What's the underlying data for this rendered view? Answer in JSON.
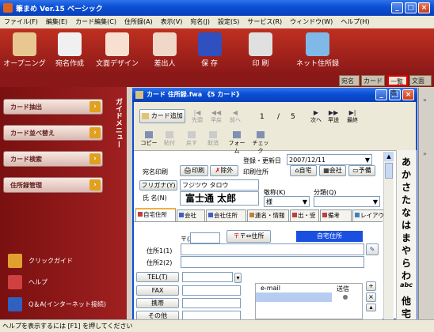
{
  "app": {
    "title": "筆まめ Ver.15 ベーシック"
  },
  "menu": [
    "ファイル(F)",
    "編集(E)",
    "カード編集(C)",
    "住所録(A)",
    "表示(V)",
    "宛名(J)",
    "設定(S)",
    "サービス(R)",
    "ウィンドウ(W)",
    "ヘルプ(H)"
  ],
  "toolbar": [
    "オープニング",
    "宛名作成",
    "文面デザイン",
    "差出人",
    "保 存",
    "印 刷",
    "ネット住所録"
  ],
  "right_tabs": [
    "宛名",
    "カード",
    "一覧表",
    "文面"
  ],
  "guide": {
    "title": "ガイドメニュー",
    "buttons": [
      "カード抽出",
      "カード並べ替え",
      "カード検索",
      "住所録管理"
    ],
    "links": [
      "クリックガイド",
      "ヘルプ",
      "Q＆A(インターネット接続)"
    ]
  },
  "card": {
    "title": "カード 住所録.fwa 《5 カード》",
    "add_btn": "カード追加",
    "nav": [
      "先頭",
      "早戻",
      "前へ"
    ],
    "page_current": "1",
    "page_sep": "/",
    "page_total": "5",
    "nav2": [
      "次へ",
      "早送",
      "最終"
    ],
    "edit": [
      "コピー",
      "貼付",
      "戻す",
      "取消",
      "フォーム",
      "チェック"
    ],
    "reg_label": "登録・更新日",
    "reg_date": "2007/12/11",
    "atena_label": "宛名印刷",
    "print_btn": "印刷",
    "exclude_btn": "除外",
    "addr_label": "印刷住所",
    "home_btn": "自宅",
    "work_btn": "会社",
    "spare_btn": "予備",
    "furigana_btn": "フリガナ(Y)",
    "furigana_val": "フジツウ タロウ",
    "name_label": "氏 名(N)",
    "name_val": "富士通 太郎",
    "title_label": "敬称(K)",
    "title_val": "様",
    "class_label": "分類(Q)",
    "tabs": [
      "自宅住所",
      "会社",
      "会社住所",
      "連名・情報",
      "出・受",
      "備考",
      "レイアウト"
    ],
    "zip_label": "〒(Z)",
    "zip_btn": "〒⇔住所",
    "home_addr_badge": "自宅住所",
    "addr1_label": "住所1(1)",
    "addr2_label": "住所2(2)",
    "contact": [
      "TEL(T)",
      "FAX",
      "携帯",
      "その他"
    ],
    "email_head": "e-mail",
    "send_head": "送信"
  },
  "vertical_kana": [
    "あ",
    "か",
    "さ",
    "た",
    "な",
    "は",
    "ま",
    "や",
    "ら",
    "わ",
    "abc",
    "他",
    "宅"
  ],
  "status": "ヘルプを表示するには [F1] を押してください"
}
